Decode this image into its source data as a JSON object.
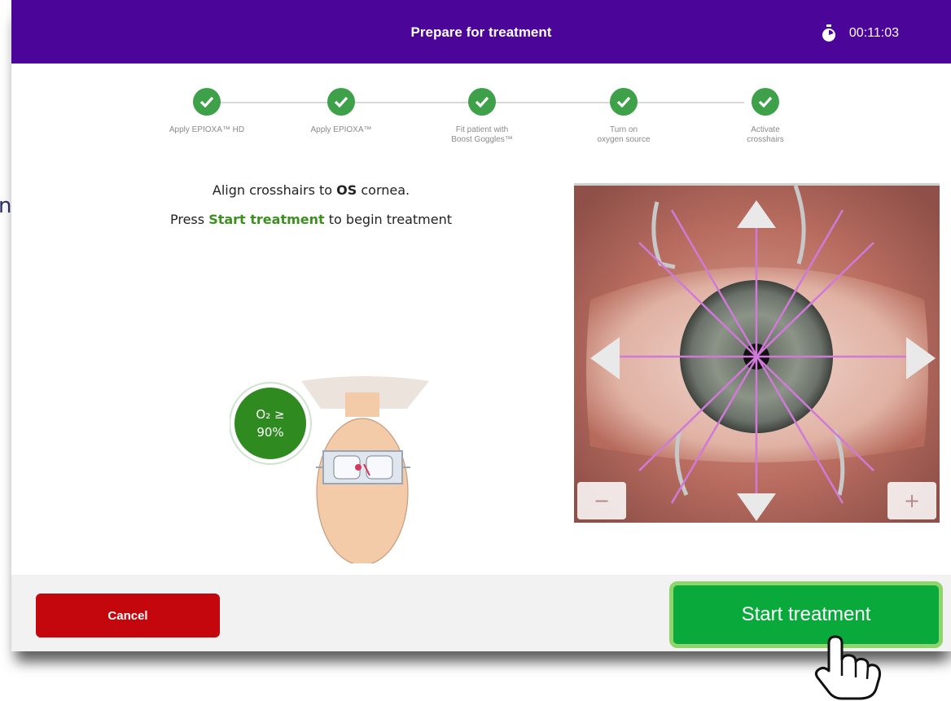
{
  "stray_text": "nt",
  "header": {
    "title": "Prepare for treatment",
    "timer": "00:11:03",
    "background": "#4b0599"
  },
  "steps": [
    {
      "label": "Apply EPIOXA™ HD",
      "status": "complete"
    },
    {
      "label": "Apply EPIOXA™",
      "status": "complete"
    },
    {
      "label": "Fit patient with\nBoost Goggles™",
      "status": "complete"
    },
    {
      "label": "Turn on\noxygen source",
      "status": "complete"
    },
    {
      "label": "Activate\ncrosshairs",
      "status": "complete"
    }
  ],
  "instructions": {
    "line1_pre": "Align crosshairs to ",
    "line1_bold": "OS",
    "line1_post": " cornea.",
    "line2_pre": "Press ",
    "line2_green": "Start treatment",
    "line2_post": " to begin treatment"
  },
  "oxygen_badge": {
    "line1": "O₂ ≥",
    "line2": "90%",
    "color": "#2f8a1f"
  },
  "camera": {
    "zoom_out_label": "−",
    "zoom_in_label": "+",
    "crosshair_color": "#d07ad8"
  },
  "footer": {
    "cancel_label": "Cancel",
    "start_label": "Start treatment"
  },
  "colors": {
    "step_complete": "#3ea14a",
    "cancel": "#c4070c",
    "start": "#09a93c",
    "start_border": "#8fd46d"
  }
}
